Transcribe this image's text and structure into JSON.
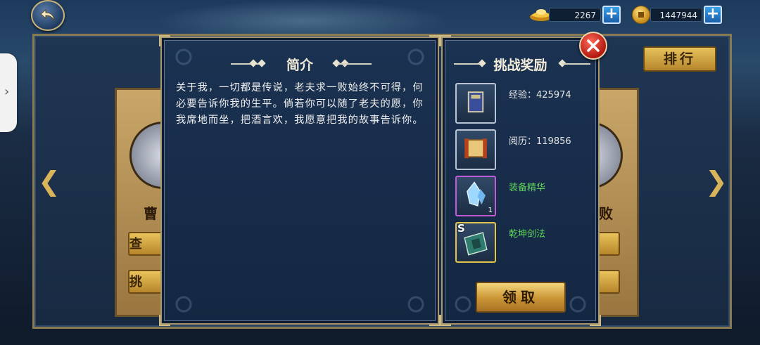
{
  "currency": {
    "gold_ingot": {
      "amount": "2267",
      "icon": "gold-ingot-icon"
    },
    "copper_coin": {
      "amount": "1447944",
      "icon": "copper-coin-icon"
    }
  },
  "top": {
    "back_icon": "back-arrow-icon"
  },
  "background": {
    "left_card": {
      "name": "曹",
      "button1": "查",
      "button2": "挑"
    },
    "right_card": {
      "name": "败"
    },
    "rank_button": "排行",
    "left_arrow": "❮",
    "right_arrow": "❯"
  },
  "intro": {
    "title": "简介",
    "text": "关于我，一切都是传说，老夫求一败始终不可得，何必要告诉你我的生平。倘若你可以随了老夫的愿，你我席地而坐，把酒言欢，我愿意把我的故事告诉你。"
  },
  "rewards": {
    "title": "挑战奖励",
    "items": [
      {
        "label": "经验：425974",
        "icon": "experience-book-icon",
        "color": "#e6e6e6"
      },
      {
        "label": "阅历：119856",
        "icon": "scroll-icon",
        "color": "#e6e6e6"
      },
      {
        "label": "装备精华",
        "icon": "crystal-icon",
        "color": "#5fd35a",
        "qty": "1"
      },
      {
        "label": "乾坤剑法",
        "icon": "skill-book-icon",
        "color": "#5fd35a",
        "badge": "S"
      }
    ],
    "claim_button": "领取"
  },
  "close_icon": "close-icon"
}
